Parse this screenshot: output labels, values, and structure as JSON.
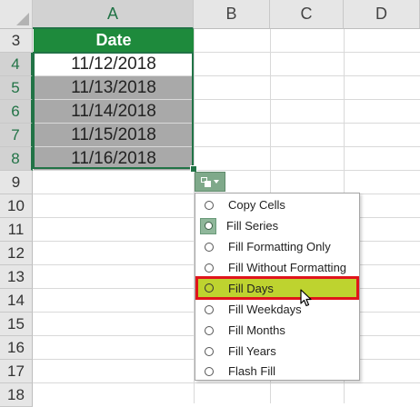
{
  "columns": [
    "A",
    "B",
    "C",
    "D"
  ],
  "rows": [
    "3",
    "4",
    "5",
    "6",
    "7",
    "8",
    "9",
    "10",
    "11",
    "12",
    "13",
    "14",
    "15",
    "16",
    "17",
    "18"
  ],
  "column_a": {
    "header": "Date",
    "values": [
      "11/12/2018",
      "11/13/2018",
      "11/14/2018",
      "11/15/2018",
      "11/16/2018"
    ]
  },
  "autofill_menu": {
    "items": [
      "Copy Cells",
      "Fill Series",
      "Fill Formatting Only",
      "Fill Without Formatting",
      "Fill Days",
      "Fill Weekdays",
      "Fill Months",
      "Fill Years",
      "Flash Fill"
    ],
    "selected": "Fill Series",
    "hovered": "Fill Days"
  },
  "colors": {
    "header_fill": "#1e8a3c",
    "selection_border": "#217346",
    "hover_highlight": "#bed32f",
    "callout_border": "#e0141b"
  },
  "icons": {
    "autofill_options": "autofill-options-icon",
    "cursor": "mouse-pointer-icon"
  }
}
